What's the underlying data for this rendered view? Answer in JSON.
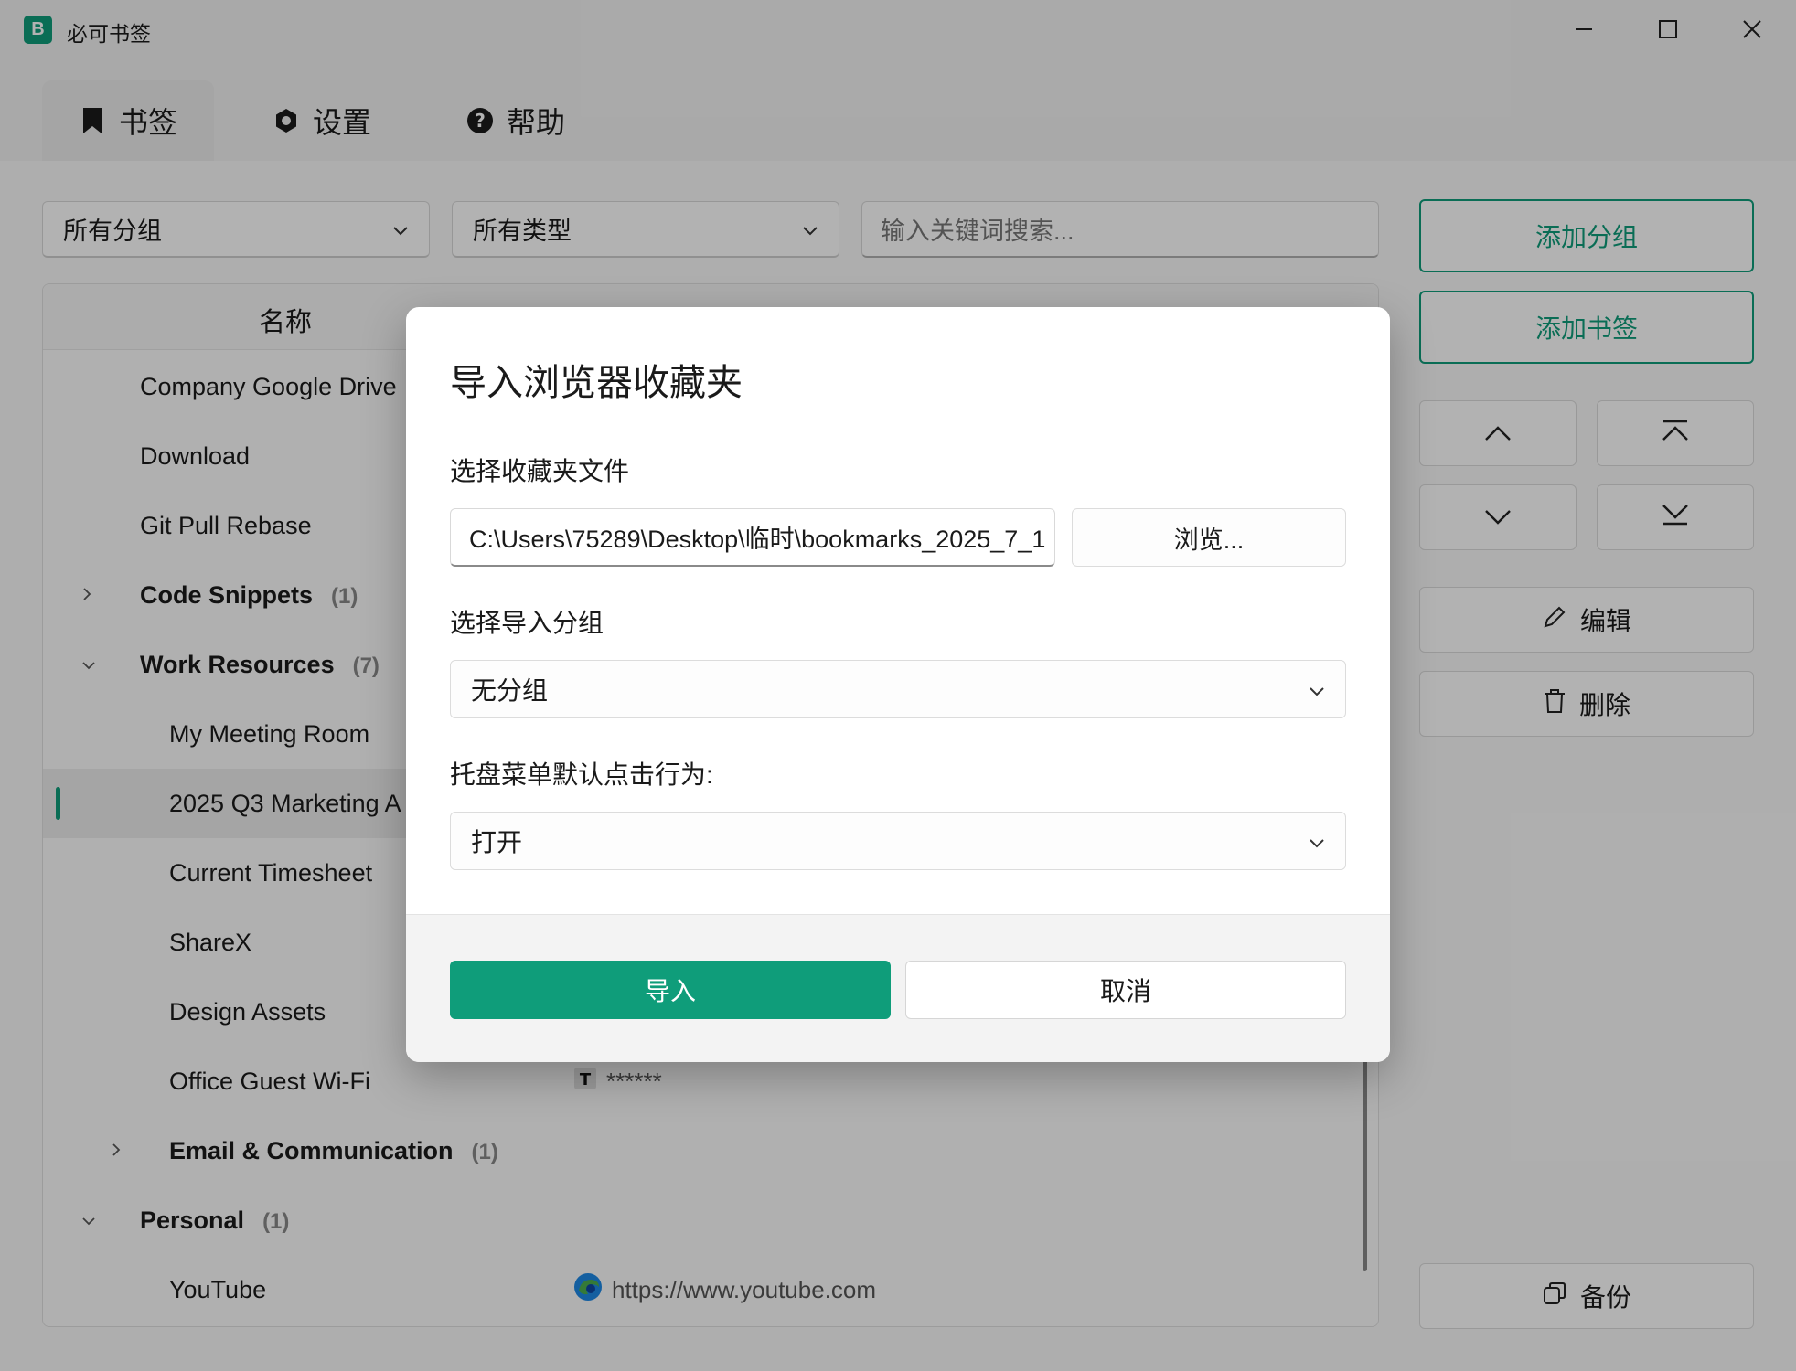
{
  "window": {
    "app_icon_letter": "B",
    "title": "必可书签"
  },
  "tabs": [
    {
      "label": "书签",
      "icon": "bookmark-icon",
      "active": true
    },
    {
      "label": "设置",
      "icon": "gear-icon",
      "active": false
    },
    {
      "label": "帮助",
      "icon": "help-icon",
      "active": false
    }
  ],
  "filters": {
    "group_select": "所有分组",
    "type_select": "所有类型",
    "search_placeholder": "输入关键词搜索..."
  },
  "side_buttons": {
    "add_group": "添加分组",
    "add_bookmark": "添加书签",
    "edit": "编辑",
    "delete": "删除",
    "backup": "备份"
  },
  "list": {
    "column_name": "名称",
    "rows": [
      {
        "label": "Company Google Drive"
      },
      {
        "label": "Download"
      },
      {
        "label": "Git Pull Rebase"
      },
      {
        "label": "Code Snippets",
        "count": "(1)"
      },
      {
        "label": "Work Resources",
        "count": "(7)"
      },
      {
        "label": "My Meeting Room"
      },
      {
        "label": "2025 Q3 Marketing A"
      },
      {
        "label": "Current Timesheet"
      },
      {
        "label": "ShareX"
      },
      {
        "label": "Design Assets"
      },
      {
        "label": "Office Guest Wi-Fi",
        "value": "******"
      },
      {
        "label": "Email & Communication",
        "count": "(1)"
      },
      {
        "label": "Personal",
        "count": "(1)"
      },
      {
        "label": "YouTube",
        "value": "https://www.youtube.com"
      }
    ]
  },
  "dialog": {
    "title": "导入浏览器收藏夹",
    "file_label": "选择收藏夹文件",
    "file_path": "C:\\Users\\75289\\Desktop\\临时\\bookmarks_2025_7_1",
    "browse": "浏览...",
    "group_label": "选择导入分组",
    "group_value": "无分组",
    "tray_label": "托盘菜单默认点击行为:",
    "tray_value": "打开",
    "import": "导入",
    "cancel": "取消"
  },
  "colors": {
    "accent": "#0f9d7a"
  }
}
